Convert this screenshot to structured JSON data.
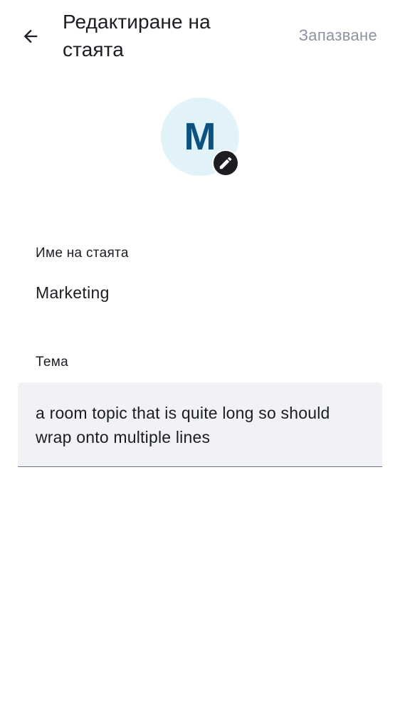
{
  "topbar": {
    "back_icon": "arrow-left-icon",
    "title": "Редактиране на стаята",
    "save_label": "Запазване"
  },
  "avatar": {
    "initial": "M",
    "edit_icon": "pencil-icon",
    "colors": {
      "background": "#e1f3f8",
      "text": "#0b5283",
      "badge": "#1b1d22"
    }
  },
  "fields": {
    "room_name": {
      "label": "Име на стаята",
      "value": "Marketing"
    },
    "topic": {
      "label": "Тема",
      "value": "a room topic that is quite long so should wrap onto multiple lines"
    }
  }
}
